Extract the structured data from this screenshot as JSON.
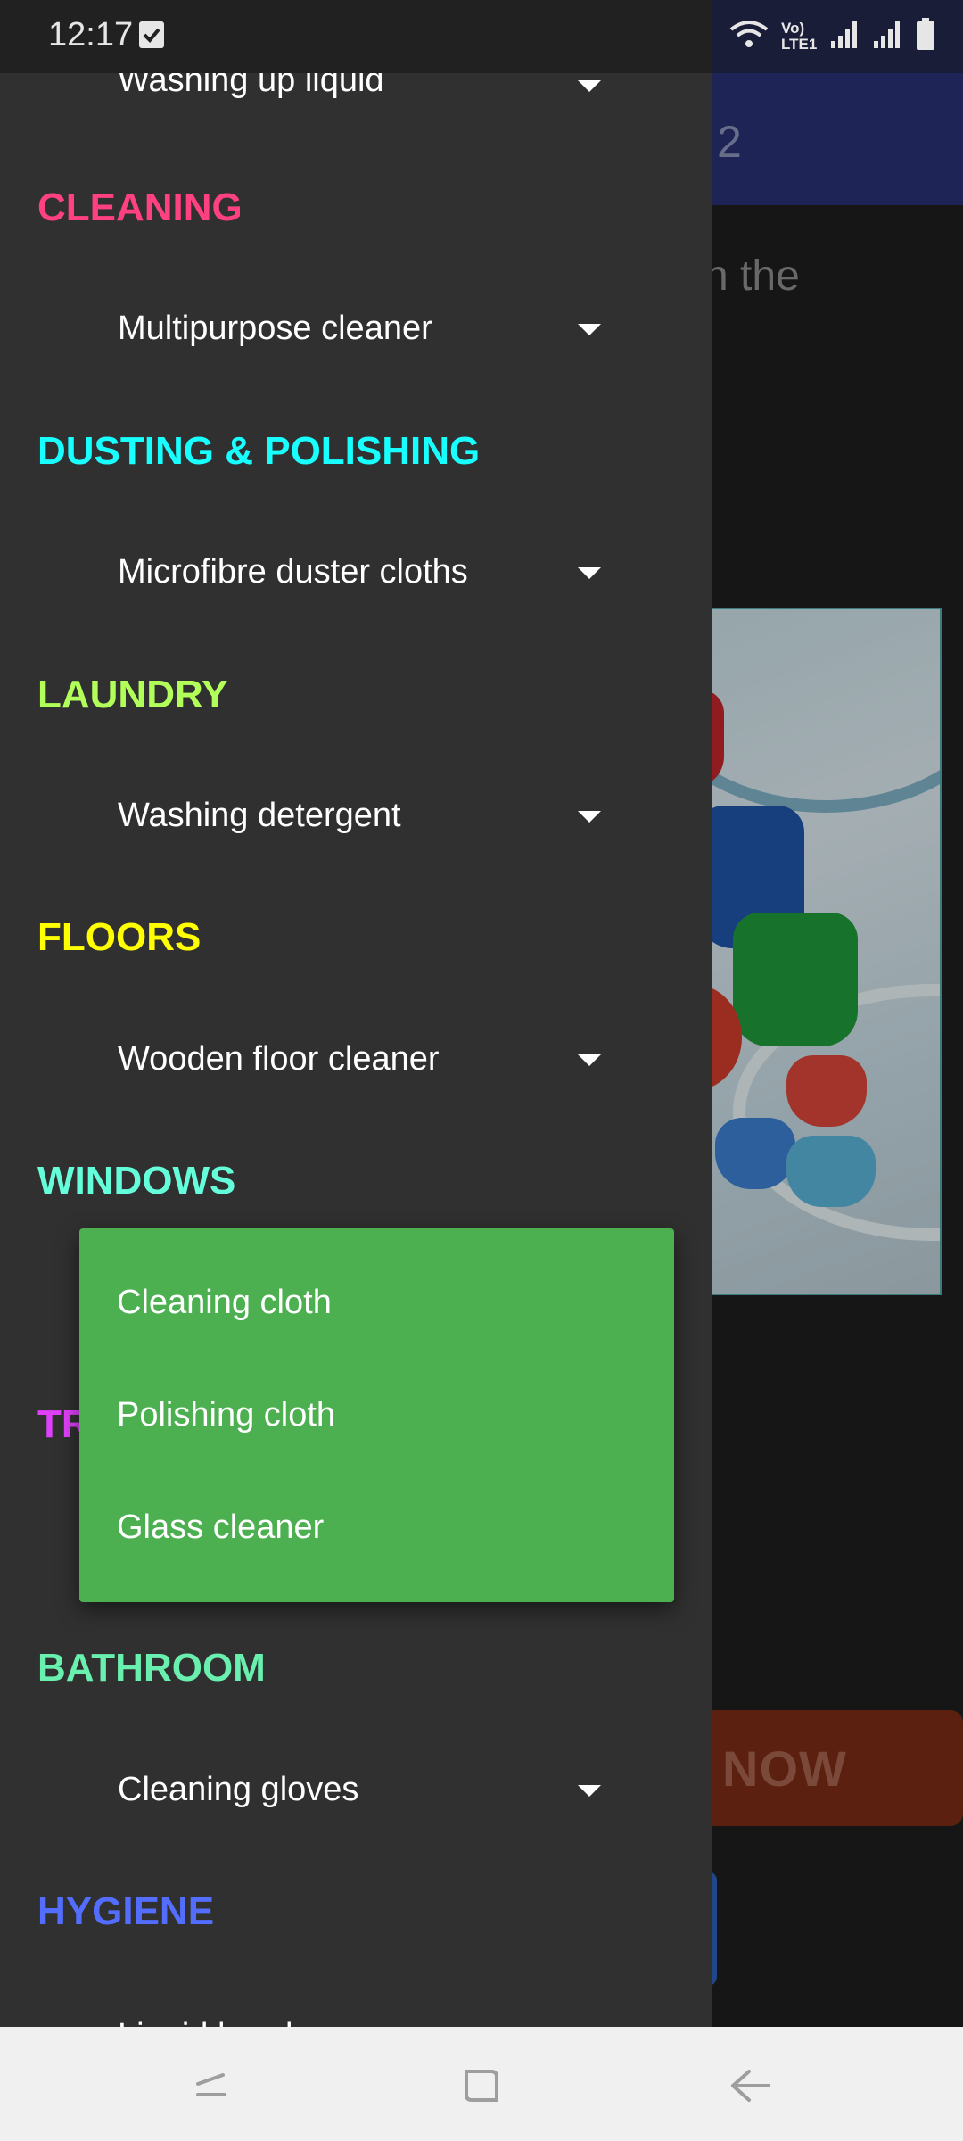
{
  "status_bar": {
    "time": "12:17",
    "network_label": "Vo) LTE1"
  },
  "background": {
    "appbar_title_fragment": "2",
    "body_text_fragment": "n the",
    "cta_label_fragment": "NOW"
  },
  "drawer": {
    "sections": [
      {
        "category": "",
        "item": "Washing up liquid",
        "color": ""
      },
      {
        "category": "CLEANING",
        "item": "Multipurpose cleaner",
        "color": "#ff4081"
      },
      {
        "category": "DUSTING & POLISHING",
        "item": "Microfibre duster cloths",
        "color": "#18ffff"
      },
      {
        "category": "LAUNDRY",
        "item": "Washing detergent",
        "color": "#b2ff59"
      },
      {
        "category": "FLOORS",
        "item": "Wooden floor cleaner",
        "color": "#ffff00"
      },
      {
        "category": "WINDOWS",
        "item": "",
        "color": "#64ffda"
      },
      {
        "category": "TR",
        "item": "",
        "color": "#e040fb"
      },
      {
        "category": "BATHROOM",
        "item": "Cleaning gloves",
        "color": "#69f0ae"
      },
      {
        "category": "HYGIENE",
        "item": "Liquid hand soap",
        "color": "#536dfe"
      }
    ]
  },
  "windows_dropdown": {
    "options": [
      "Cleaning cloth",
      "Polishing cloth",
      "Glass cleaner"
    ],
    "background_color": "#4caf50"
  },
  "icons": {
    "status": [
      "checkbox-notification-icon",
      "wifi-icon",
      "signal-icon",
      "signal-icon-2",
      "battery-icon"
    ],
    "nav": [
      "recents-icon",
      "home-icon",
      "back-icon"
    ]
  }
}
